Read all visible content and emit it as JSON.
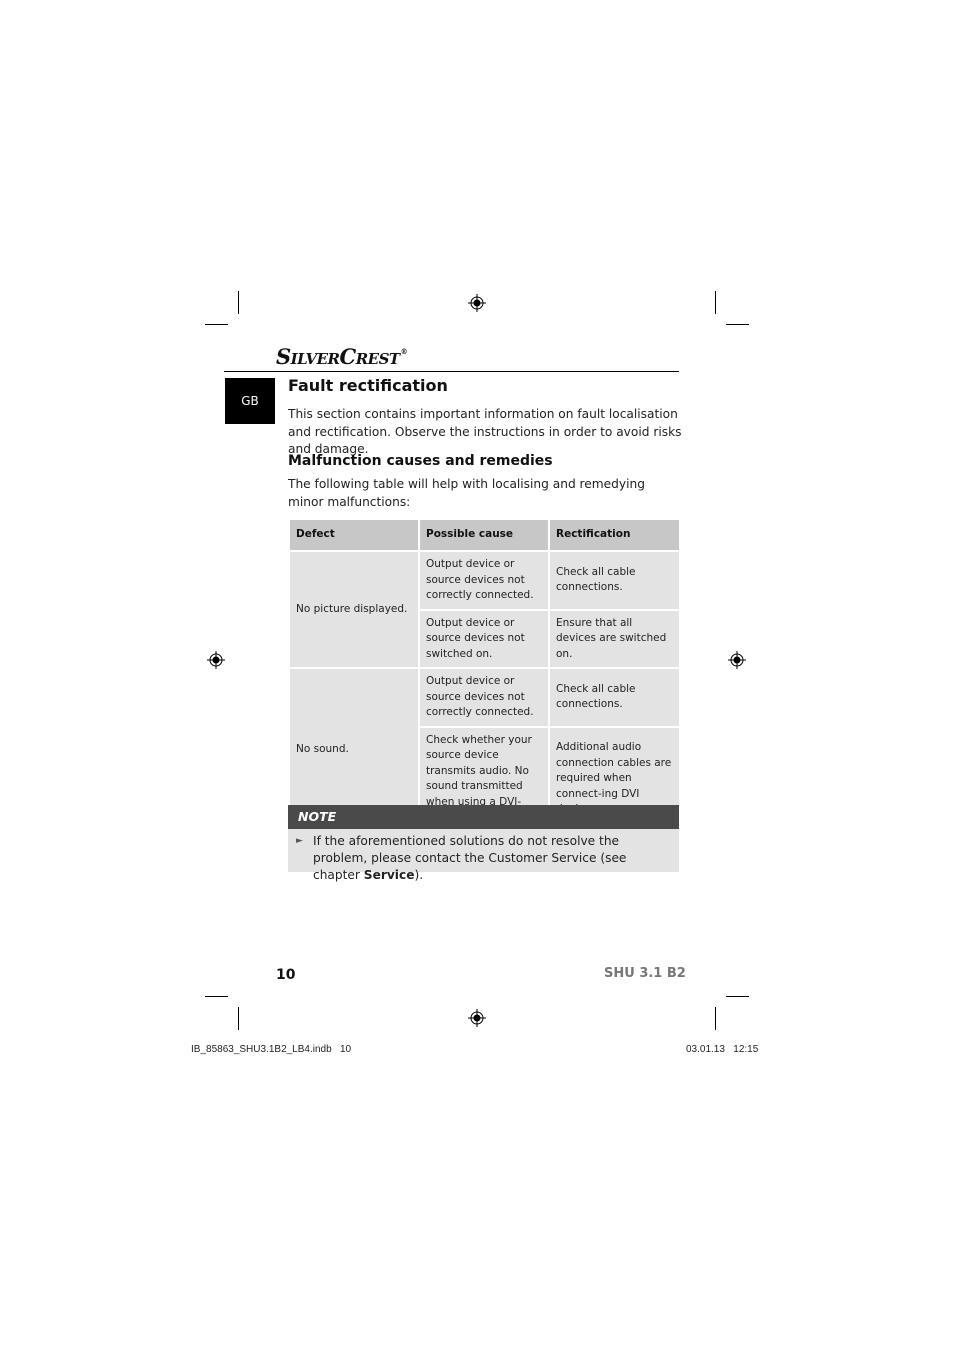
{
  "brand": {
    "name": "SilverCrest",
    "trademark": "®"
  },
  "language_tab": "GB",
  "section": {
    "title": "Fault rectification",
    "intro": "This section contains important information on fault localisation and rectification. Observe the instructions in order to avoid risks and damage."
  },
  "subsection": {
    "title": "Malfunction causes and remedies",
    "intro": "The following table will help with localising and remedying minor malfunctions:"
  },
  "table": {
    "headers": [
      "Defect",
      "Possible cause",
      "Rectification"
    ],
    "groups": [
      {
        "defect": "No picture displayed.",
        "rows": [
          {
            "cause": "Output device or source devices not correctly connected.",
            "rectification": "Check all cable connections."
          },
          {
            "cause": "Output device or source devices not switched on.",
            "rectification": "Ensure that all devices are switched on."
          }
        ]
      },
      {
        "defect": "No sound.",
        "rows": [
          {
            "cause": "Output device or source devices not correctly connected.",
            "rectification": "Check all cable connections."
          },
          {
            "cause": "Check whether your source device transmits audio. No sound transmitted when using a DVI-HDMI adapter.",
            "rectification": "Additional audio connection cables are required when connect-ing DVI devices."
          }
        ]
      }
    ]
  },
  "note": {
    "label": "NOTE",
    "text_before": "If the aforementioned solutions do not resolve the problem, please contact the Customer Service (see chapter ",
    "text_bold": "Service",
    "text_after": ")."
  },
  "footer": {
    "page_number": "10",
    "model": "SHU 3.1 B2"
  },
  "print_slug": {
    "file": "IB_85863_SHU3.1B2_LB4.indb   10",
    "datetime": "03.01.13   12:15"
  },
  "colors": {
    "header_cell": "#c7c7c7",
    "body_cell": "#e3e3e3",
    "note_header": "#4a4a4a",
    "model_text": "#777777"
  }
}
